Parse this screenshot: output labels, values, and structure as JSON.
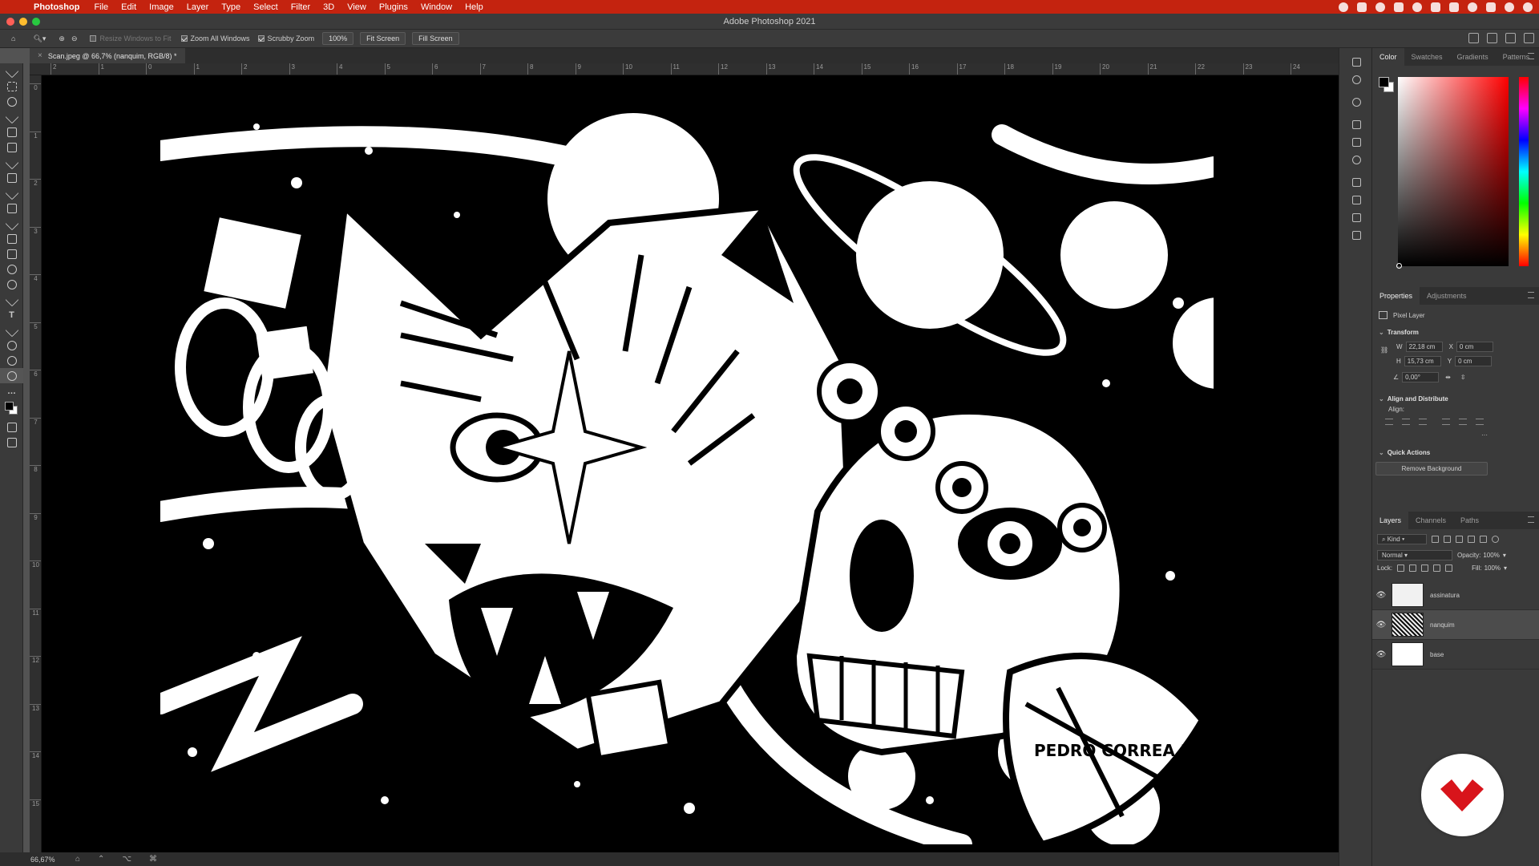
{
  "menubar": {
    "app": "Photoshop",
    "items": [
      "File",
      "Edit",
      "Image",
      "Layer",
      "Type",
      "Select",
      "Filter",
      "3D",
      "View",
      "Plugins",
      "Window",
      "Help"
    ]
  },
  "window": {
    "title": "Adobe Photoshop 2021"
  },
  "options_bar": {
    "resize_windows": "Resize Windows to Fit",
    "zoom_all_windows": "Zoom All Windows",
    "scrubby_zoom": "Scrubby Zoom",
    "zoom_percent": "100%",
    "fit_screen": "Fit Screen",
    "fill_screen": "Fill Screen"
  },
  "document": {
    "tab_title": "Scan.jpeg @ 66,7% (nanquim, RGB/8) *",
    "zoom": "66,67%",
    "signature_text": "PEDRO CORREA 21"
  },
  "rulers": {
    "horizontal": [
      "2",
      "1",
      "0",
      "1",
      "2",
      "3",
      "4",
      "5",
      "6",
      "7",
      "8",
      "9",
      "10",
      "11",
      "12",
      "13",
      "14",
      "15",
      "16",
      "17",
      "18",
      "19",
      "20",
      "21",
      "22",
      "23",
      "24"
    ],
    "vertical": [
      "0",
      "1",
      "2",
      "3",
      "4",
      "5",
      "6",
      "7",
      "8",
      "9",
      "10",
      "11",
      "12",
      "13",
      "14",
      "15"
    ]
  },
  "color_panel": {
    "tabs": [
      "Color",
      "Swatches",
      "Gradients",
      "Patterns"
    ],
    "active_tab": "Color",
    "foreground": "#000000",
    "background": "#ffffff",
    "hue": "#ff0000"
  },
  "properties_panel": {
    "tabs": [
      "Properties",
      "Adjustments"
    ],
    "layer_type": "Pixel Layer",
    "transform_label": "Transform",
    "w_label": "W",
    "w": "22,18 cm",
    "h_label": "H",
    "h": "15,73 cm",
    "x_label": "X",
    "x": "0 cm",
    "y_label": "Y",
    "y": "0 cm",
    "angle": "0,00°",
    "align_label": "Align and Distribute",
    "align_sub": "Align:",
    "quick_actions_label": "Quick Actions",
    "remove_background": "Remove Background"
  },
  "layers_panel": {
    "tabs": [
      "Layers",
      "Channels",
      "Paths"
    ],
    "filter": "Kind",
    "blend_mode": "Normal",
    "opacity_label": "Opacity:",
    "opacity": "100%",
    "lock_label": "Lock:",
    "fill_label": "Fill:",
    "fill": "100%",
    "layers": [
      {
        "name": "assinatura",
        "visible": true,
        "active": false
      },
      {
        "name": "nanquim",
        "visible": true,
        "active": true
      },
      {
        "name": "base",
        "visible": true,
        "active": false
      }
    ]
  },
  "colors": {
    "menubar": "#c4230f",
    "badge_red": "#d8141b"
  }
}
